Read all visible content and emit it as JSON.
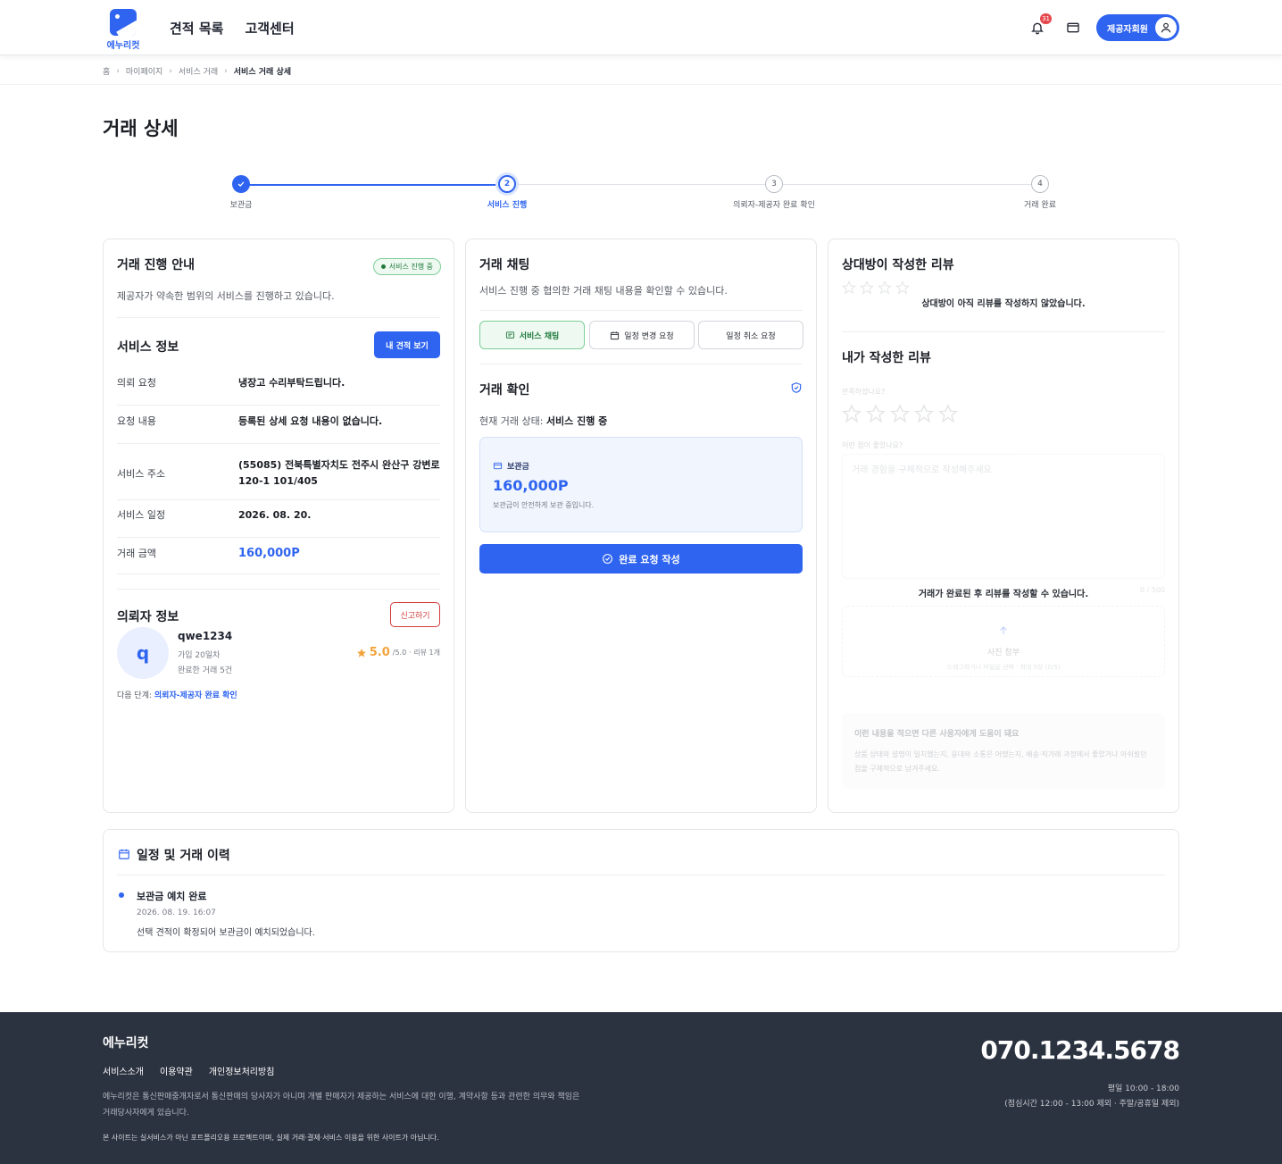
{
  "header": {
    "logo_text": "에누리컷",
    "nav": [
      "견적 목록",
      "고객센터"
    ],
    "notification_count": "31",
    "member_label": "제공자회원"
  },
  "breadcrumb": [
    "홈",
    "마이페이지",
    "서비스 거래",
    "서비스 거래 상세"
  ],
  "page_title": "거래 상세",
  "stepper": {
    "steps": [
      {
        "num": "",
        "label": "보관금",
        "state": "done"
      },
      {
        "num": "2",
        "label": "서비스 진행",
        "state": "current"
      },
      {
        "num": "3",
        "label": "의뢰자-제공자 완료 확인",
        "state": "todo"
      },
      {
        "num": "4",
        "label": "거래 완료",
        "state": "todo"
      }
    ]
  },
  "guide": {
    "title": "거래 진행 안내",
    "status": "서비스 진행 중",
    "desc": "제공자가 약속한 범위의 서비스를 진행하고 있습니다."
  },
  "service_info": {
    "title": "서비스 정보",
    "button": "내 견적 보기",
    "rows": [
      {
        "k": "의뢰 요청",
        "v": "냉장고 수리부탁드립니다."
      },
      {
        "k": "요청 내용",
        "v": "등록된 상세 요청 내용이 없습니다."
      },
      {
        "k": "서비스 주소",
        "v": "(55085) 전북특별자치도 전주시 완산구 강변로 120-1 101/405"
      },
      {
        "k": "서비스 일정",
        "v": "2026. 08. 20."
      },
      {
        "k": "거래 금액",
        "v": "160,000P"
      }
    ]
  },
  "client_info": {
    "title": "의뢰자 정보",
    "report_button": "신고하기",
    "avatar_letter": "q",
    "username": "qwe1234",
    "joined": "가입 20일차",
    "completed": "완료한 거래 5건",
    "rating": "5.0",
    "rating_max": "/5.0",
    "review_count": "· 리뷰 1개",
    "next_step_label": "다음 단계:",
    "next_step_value": "의뢰자-제공자 완료 확인"
  },
  "chat": {
    "title": "거래 채팅",
    "desc": "서비스 진행 중 협의한 거래 채팅 내용을 확인할 수 있습니다.",
    "tabs": [
      "서비스 채팅",
      "일정 변경 요청",
      "일정 취소 요청"
    ]
  },
  "confirm": {
    "title": "거래 확인",
    "status_label": "현재 거래 상태:",
    "status_value": "서비스 진행 중",
    "escrow_label": "보관금",
    "escrow_amount": "160,000P",
    "escrow_note": "보관금이 안전하게 보관 중입니다.",
    "action_button": "완료 요청 작성"
  },
  "review": {
    "other_title": "상대방이 작성한 리뷰",
    "other_empty": "상대방이 아직 리뷰를 작성하지 않았습니다.",
    "my_title": "내가 작성한 리뷰",
    "q_satisfaction": "만족하셨나요?",
    "q_good": "어떤 점이 좋았나요?",
    "placeholder": "거래 경험을 구체적으로 작성해주세요",
    "counter": "0 / 500",
    "locked_msg": "거래가 완료된 후 리뷰를 작성할 수 있습니다.",
    "photo_label": "사진 첨부",
    "photo_hint": "드래그하거나 파일을 선택 · 최대 5장 (0/5)",
    "tip_title": "이런 내용을 적으면 다른 사용자에게 도움이 돼요",
    "tip_body": "상품 상태와 설명이 일치했는지, 응대와 소통은 어땠는지, 배송·직거래 과정에서 좋았거나 아쉬웠던 점을 구체적으로 남겨주세요."
  },
  "history": {
    "title": "일정 및 거래 이력",
    "items": [
      {
        "title": "보관금 예치 완료",
        "time": "2026. 08. 19. 16:07",
        "desc": "선택 견적이 확정되어 보관금이 예치되었습니다."
      }
    ]
  },
  "footer": {
    "logo": "에누리컷",
    "links": [
      "서비스소개",
      "이용약관",
      "개인정보처리방침"
    ],
    "disclaimer1": "에누리컷은 통신판매중개자로서 통신판매의 당사자가 아니며 개별 판매자가 제공하는 서비스에 대한 이행, 계약사항 등과 관련한 의무와 책임은 거래당사자에게 있습니다.",
    "disclaimer2": "본 사이트는 실서비스가 아닌 포트폴리오용 프로젝트이며, 실제 거래·결제·서비스 이용을 위한 사이트가 아닙니다.",
    "phone": "070.1234.5678",
    "hours1": "평일 10:00 - 18:00",
    "hours2": "(점심시간 12:00 - 13:00 제외 · 주말/공휴일 제외)"
  },
  "colors": {
    "primary": "#2f64f0",
    "success": "#1f7a3c",
    "danger": "#d23a3a",
    "footer": "#2c3340"
  }
}
